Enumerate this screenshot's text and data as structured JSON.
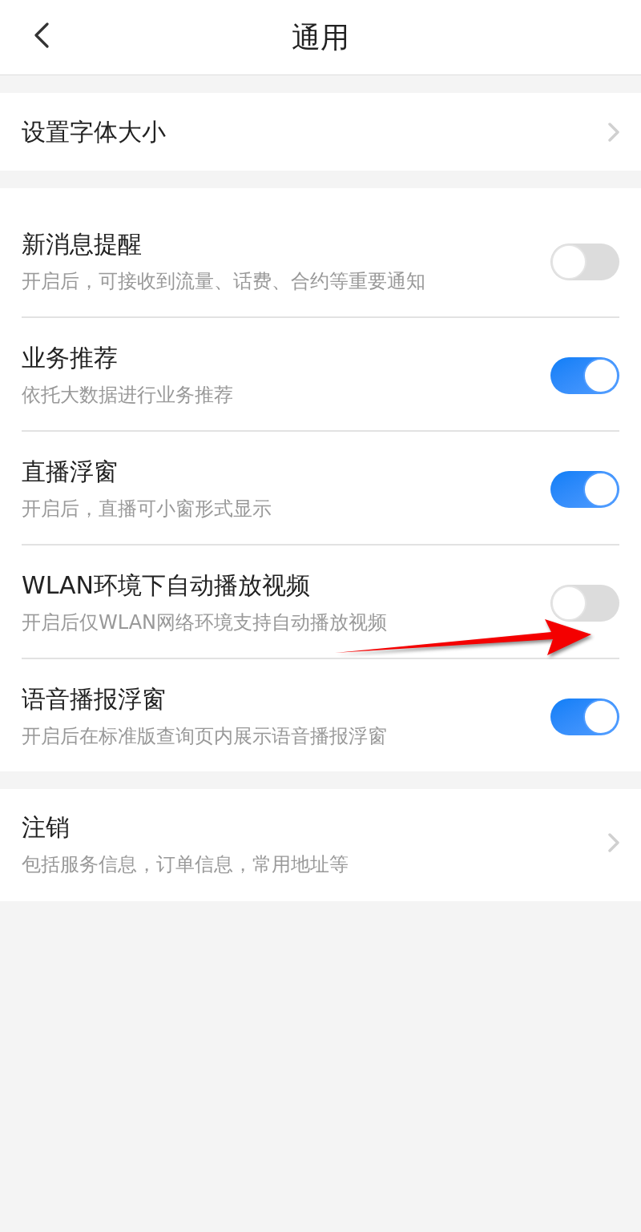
{
  "header": {
    "title": "通用"
  },
  "sections": [
    {
      "items": [
        {
          "kind": "link",
          "title": "设置字体大小"
        }
      ]
    },
    {
      "items": [
        {
          "kind": "toggle",
          "title": "新消息提醒",
          "subtitle": "开启后，可接收到流量、话费、合约等重要通知",
          "on": false
        },
        {
          "kind": "toggle",
          "title": "业务推荐",
          "subtitle": "依托大数据进行业务推荐",
          "on": true
        },
        {
          "kind": "toggle",
          "title": "直播浮窗",
          "subtitle": "开启后，直播可小窗形式显示",
          "on": true
        },
        {
          "kind": "toggle",
          "title": "WLAN环境下自动播放视频",
          "subtitle": "开启后仅WLAN网络环境支持自动播放视频",
          "on": false
        },
        {
          "kind": "toggle",
          "title": "语音播报浮窗",
          "subtitle": "开启后在标准版查询页内展示语音播报浮窗",
          "on": true
        }
      ]
    },
    {
      "items": [
        {
          "kind": "link",
          "title": "注销",
          "subtitle": "包括服务信息，订单信息，常用地址等"
        }
      ]
    }
  ]
}
